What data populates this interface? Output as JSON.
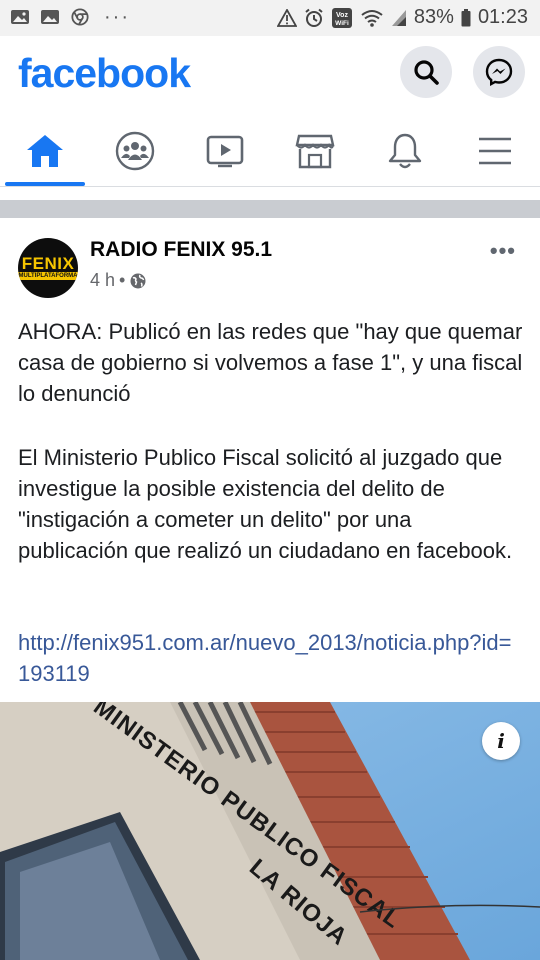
{
  "status_bar": {
    "battery": "83%",
    "time": "01:23",
    "volte_label": "Voz\nWiFi",
    "left_icons": [
      "image-icon",
      "image-icon",
      "chrome-icon"
    ],
    "overflow": "···"
  },
  "header": {
    "logo": "facebook",
    "brand_color": "#1877f2"
  },
  "nav": {
    "items": [
      "home-icon",
      "groups-icon",
      "watch-icon",
      "marketplace-icon",
      "notifications-icon",
      "menu-icon"
    ],
    "active": "home-icon"
  },
  "post": {
    "avatar_text": "FENIX",
    "avatar_subtext": "MULTIPLATAFORMA",
    "page_name": "RADIO FENIX 95.1",
    "time": "4 h",
    "separator": "•",
    "headline": "AHORA: Publicó en las redes que \"hay que quemar casa de gobierno si volvemos a fase 1\", y una fiscal lo denunció",
    "body": "El Ministerio Publico Fiscal solicitó al juzgado que investigue la posible existencia del delito de \"instigación a cometer un delito\" por una publicación que realizó un ciudadano en facebook.",
    "link": "http://fenix951.com.ar/nuevo_2013/noticia.php?id=193119",
    "image_text_line1": "MINISTERIO PUBLICO FISCAL",
    "image_text_line2": "LA RIOJA",
    "info_label": "i",
    "more_label": "•••"
  }
}
